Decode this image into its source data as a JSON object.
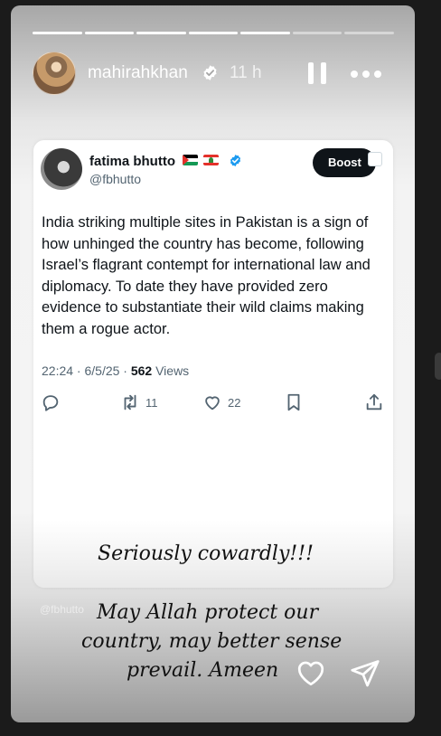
{
  "story": {
    "segments_total": 7,
    "segments_done": 5,
    "user": {
      "username": "mahirahkhan",
      "time_ago": "11 h",
      "verified": true
    }
  },
  "tweet": {
    "author_name": "fatima bhutto",
    "author_handle": "@fbhutto",
    "verified": true,
    "flags": [
      "palestine-flag",
      "lebanon-flag"
    ],
    "boost_label": "Boost",
    "text": "India striking multiple sites in Pakistan is a sign of how unhinged the country has become, following Israel’s flagrant contempt for international law and diplomacy. To date they have provided zero evidence to substantiate their wild claims making them a rogue actor.",
    "timestamp": "22:24 · 6/5/25 · ",
    "views_count": "562",
    "views_label": " Views",
    "replies": "",
    "reposts": "11",
    "likes": "22"
  },
  "captions": {
    "line1": "Seriously cowardly!!!",
    "line2": "May Allah protect our",
    "line3": "country, may better sense",
    "line4": "prevail. Ameen"
  },
  "watermark": "@fbhutto",
  "colors": {
    "verified_blue": "#1d9bf0",
    "boost_bg": "#0f1419",
    "text_primary": "#0f1419",
    "text_secondary": "#536471"
  },
  "icons": {
    "reply": "reply-icon",
    "repost": "repost-icon",
    "like": "like-icon",
    "bookmark": "bookmark-icon",
    "share": "share-icon",
    "story_like": "heart-icon",
    "story_send": "send-icon"
  }
}
